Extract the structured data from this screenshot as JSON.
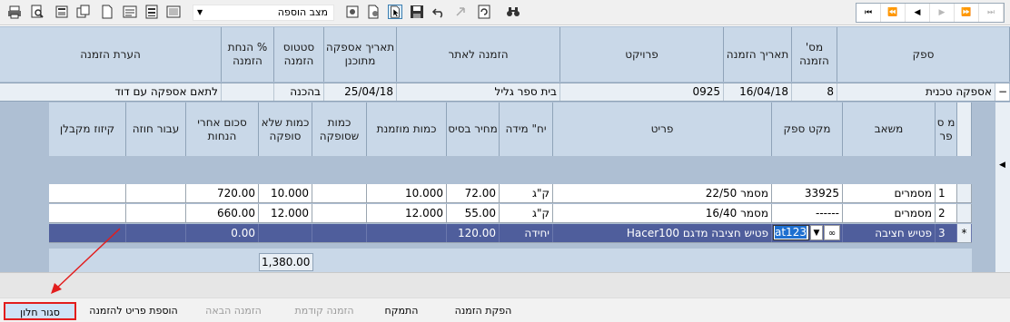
{
  "toolbar": {
    "icons": [
      "print-icon",
      "print-preview-icon",
      "export-icon",
      "copy-icon",
      "new-document-icon",
      "form-icon",
      "properties-icon",
      "grid-view-icon"
    ],
    "mode_select": "מצב הוספה",
    "right_icons": [
      "settings-icon",
      "cursor-select-icon",
      "save-icon",
      "undo-icon",
      "redo-icon",
      "refresh-icon",
      "binoculars-icon"
    ]
  },
  "navigator": {
    "buttons": [
      "⏮",
      "⏪",
      "◀",
      "▶",
      "⏩",
      "⏭"
    ]
  },
  "order_header": {
    "columns": [
      "ספק",
      "מס' הזמנה",
      "תאריך הזמנה",
      "פרויקט",
      "הזמנה לאתר",
      "תאריך אספקה מתוכנן",
      "סטטוס הזמנה",
      "% הנחת הזמנה",
      "הערת הזמנה"
    ],
    "row": {
      "expand": "−",
      "supplier": "אספקה טכנית",
      "order_no": "8",
      "order_date": "16/04/18",
      "project": "0925",
      "site": "בית ספר גליל",
      "delivery_date": "25/04/18",
      "status": "בהכנה",
      "discount": "",
      "note": "לתאם אספקה עם דוד"
    }
  },
  "items": {
    "columns": [
      "מ ס פר",
      "משאב",
      "מקט ספק",
      "פריט",
      "יח\" מידה",
      "מחיר בסיס",
      "כמות מוזמנת",
      "כמות שסופקה",
      "כמות שלא סופקה",
      "סכום אחרי הנחות",
      "עבור חוזה",
      "קיזוז מקבלן"
    ],
    "rows": [
      {
        "num": "1",
        "resource": "מסמרים",
        "supplier_sku": "33925",
        "item": "מסמר 22/50",
        "unit": "ק\"ג",
        "price": "72.00",
        "ordered": "10.000",
        "supplied": "",
        "unsupplied": "10.000",
        "amount": "720.00",
        "contract": "",
        "deduction": ""
      },
      {
        "num": "2",
        "resource": "מסמרים",
        "supplier_sku": "------",
        "item": "מסמר 16/40",
        "unit": "ק\"ג",
        "price": "55.00",
        "ordered": "12.000",
        "supplied": "",
        "unsupplied": "12.000",
        "amount": "660.00",
        "contract": "",
        "deduction": ""
      },
      {
        "num": "3",
        "marker": "*",
        "resource": "פטיש חציבה",
        "supplier_sku": "at123",
        "item": "פטיש חציבה מדגם Hacer100",
        "unit": "יחידה",
        "price": "120.00",
        "ordered": "",
        "supplied": "",
        "unsupplied": "",
        "amount": "0.00",
        "contract": "",
        "deduction": ""
      }
    ],
    "total": "1,380.00"
  },
  "buttons": {
    "close_window": "סגור חלון",
    "add_item": "הוספת פריט להזמנה",
    "next_order": "הזמנה הבאה",
    "prev_order": "הזמנה קודמת",
    "align": "התמקח",
    "issue_order": "הפקת הזמנה"
  },
  "colors": {
    "header_bg": "#c9d8e8",
    "grid_bg": "#aebfd3",
    "selected_row": "#4f5e9c",
    "highlight_border": "#e21d1d"
  }
}
